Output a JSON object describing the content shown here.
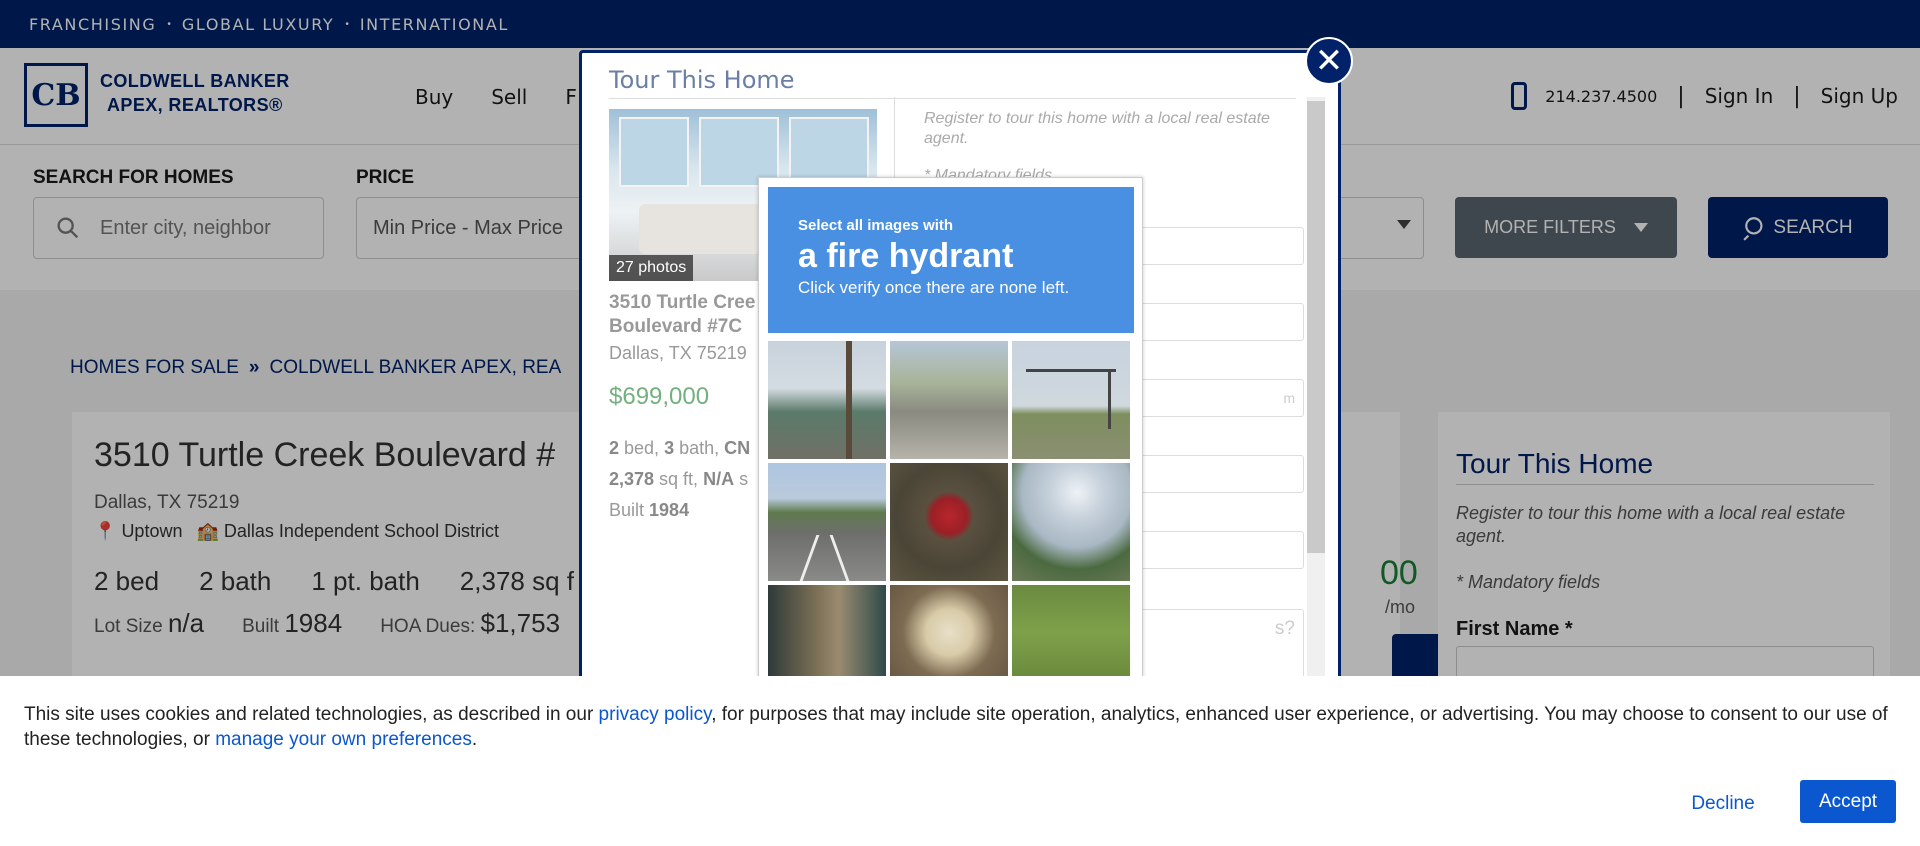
{
  "topbar": {
    "items": [
      "FRANCHISING",
      "GLOBAL LUXURY",
      "INTERNATIONAL"
    ],
    "separator": "•"
  },
  "header": {
    "logo_mark": "CB",
    "logo_line1": "COLDWELL BANKER",
    "logo_line2": "APEX, REALTORS®",
    "nav": [
      "Buy",
      "Sell",
      "F"
    ],
    "phone": "214.237.4500",
    "pipe": "|",
    "sign_in": "Sign In",
    "sign_up": "Sign Up"
  },
  "search": {
    "label_homes": "SEARCH FOR HOMES",
    "placeholder": "Enter city, neighbor",
    "label_price": "PRICE",
    "price_value": "Min Price  -  Max Price",
    "more_filters": "MORE FILTERS",
    "search_button": "SEARCH"
  },
  "breadcrumb": {
    "items": [
      "HOMES FOR SALE",
      "COLDWELL BANKER APEX, REA"
    ],
    "separator": "»"
  },
  "listing": {
    "title": "3510 Turtle Creek Boulevard #",
    "city": "Dallas, TX 75219",
    "neighborhood": "Uptown",
    "school": "Dallas Independent School District",
    "beds": "2 bed",
    "baths": "2 bath",
    "half_baths": "1 pt. bath",
    "sqft": "2,378 sq f",
    "lot_label": "Lot Size",
    "lot_value": "n/a",
    "built_label": "Built",
    "built_value": "1984",
    "hoa_label": "HOA Dues:",
    "hoa_value": "$1,753",
    "price_partial": "00",
    "mo_partial": "/mo"
  },
  "side_panel": {
    "title": "Tour This Home",
    "description": "Register to tour this home with a local real estate agent.",
    "mandatory": "* Mandatory fields",
    "first_name_label": "First Name *"
  },
  "modal": {
    "title": "Tour This Home",
    "photo_count": "27 photos",
    "address_line1": "3510 Turtle Cree",
    "address_line2": "Boulevard #7C",
    "city": "Dallas, TX 75219",
    "price": "$699,000",
    "beds_num": "2",
    "beds_label": " bed, ",
    "baths_num": "3",
    "baths_label": " bath, ",
    "cn": "CN",
    "sqft_num": "2,378",
    "sqft_label": " sq ft, ",
    "na": "N/A",
    "s_partial": " s",
    "built_label": "Built ",
    "built_value": "1984",
    "register_text": "Register to tour this home with a local real estate agent.",
    "mandatory": "* Mandatory fields",
    "email_partial": "m",
    "textarea_partial": "s?",
    "close_symbol": "✕"
  },
  "captcha": {
    "instruction": "Select all images with",
    "target": "a fire hydrant",
    "subtext": "Click verify once there are none left.",
    "tiles": [
      "road with pine tree",
      "street intersection",
      "traffic signals",
      "parking lot with palms",
      "red fire hydrant",
      "sunny field",
      "hydrant close-up",
      "yellow fire hydrant",
      "grass field"
    ]
  },
  "cookie": {
    "text_before": "This site uses cookies and related technologies, as described in our ",
    "privacy_link": "privacy policy",
    "text_middle": ", for purposes that may include site operation, analytics, enhanced user experience, or advertising. You may choose to consent to our use of these technologies, or ",
    "preferences_link": "manage your own preferences",
    "text_end": ".",
    "decline": "Decline",
    "accept": "Accept"
  },
  "colors": {
    "brand_navy": "#012169",
    "price_green": "#1a7f37",
    "captcha_blue": "#4a90e2",
    "link_blue": "#0b57d0"
  }
}
